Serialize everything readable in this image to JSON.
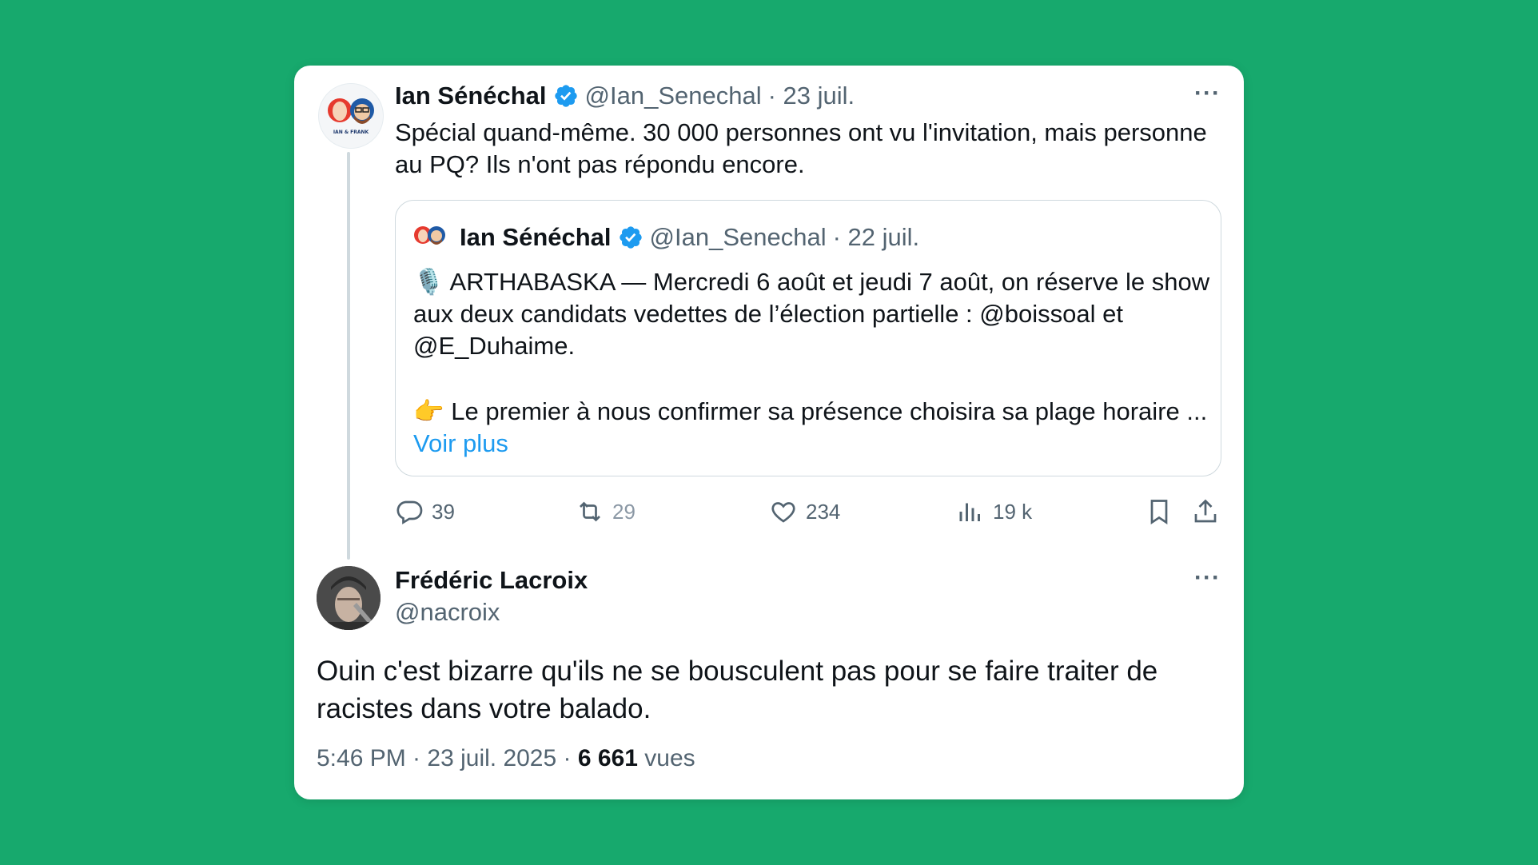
{
  "original": {
    "author_name": "Ian Sénéchal",
    "author_handle": "@Ian_Senechal",
    "date": "· 23 juil.",
    "text": "Spécial quand-même. 30 000 personnes ont vu l'invitation, mais personne au PQ? Ils n'ont pas répondu encore.",
    "avatar_label": "IAN & FRANK",
    "more_label": "···",
    "quote": {
      "author_name": "Ian Sénéchal",
      "author_handle": "@Ian_Senechal",
      "date": "· 22 juil.",
      "line1": "ARTHABASKA — Mercredi 6 août et jeudi 7 août, on réserve le show aux deux candidats vedettes de l’élection partielle : @boissoal et @E_Duhaime.",
      "line2": "Le premier à nous confirmer sa présence choisira sa plage horaire ...",
      "emoji1": "🎙️",
      "emoji2": "👉",
      "see_more": "Voir plus"
    },
    "actions": {
      "replies": "39",
      "retweets": "29",
      "likes": "234",
      "views": "19 k"
    }
  },
  "reply": {
    "author_name": "Frédéric Lacroix",
    "author_handle": "@nacroix",
    "more_label": "···",
    "text": "Ouin c'est bizarre qu'ils ne se bousculent pas pour se faire traiter de racistes dans votre balado.",
    "time": "5:46 PM · 23 juil. 2025 ·",
    "views_count": "6 661",
    "views_label": "vues"
  },
  "colors": {
    "background": "#17a96d",
    "verified": "#1d9bf0",
    "link": "#1d9bf0",
    "muted": "#536471"
  }
}
